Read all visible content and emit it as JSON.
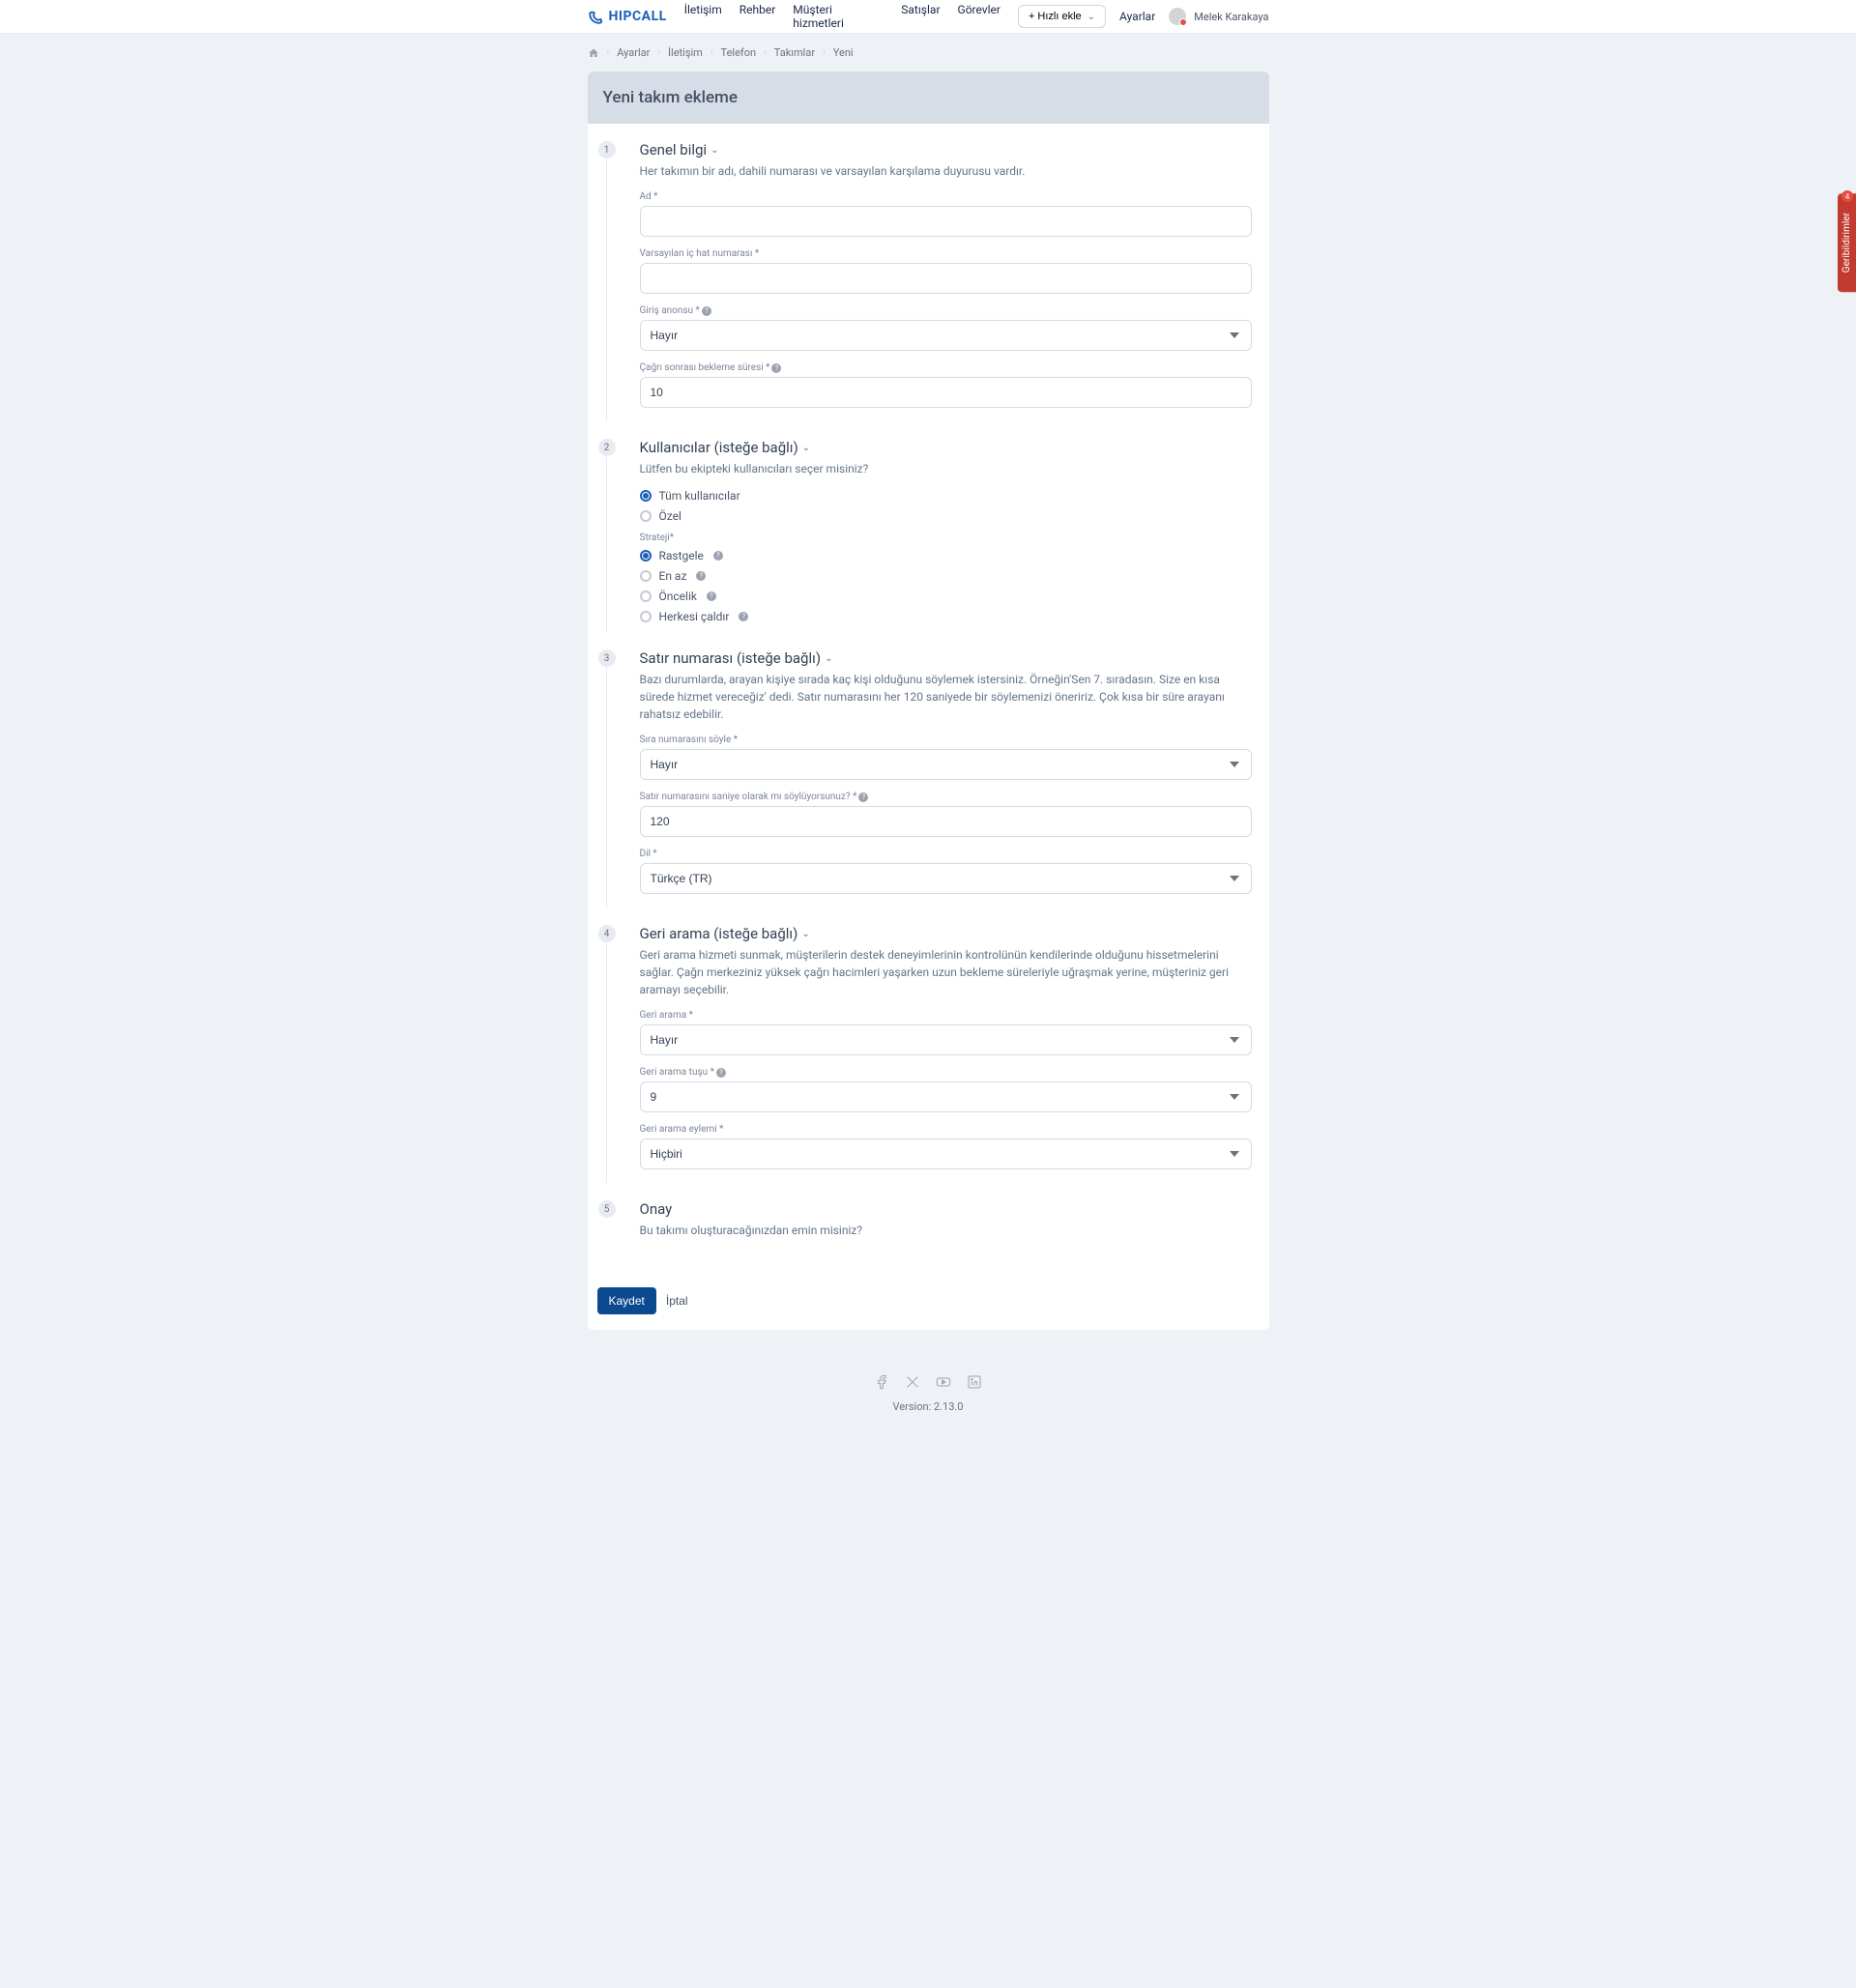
{
  "brand": "HIPCALL",
  "nav": {
    "items": [
      "İletişim",
      "Rehber",
      "Müşteri hizmetleri",
      "Satışlar",
      "Görevler"
    ]
  },
  "header": {
    "quick_add": "+ Hızlı ekle",
    "settings": "Ayarlar",
    "user_name": "Melek Karakaya"
  },
  "breadcrumb": {
    "items": [
      "Ayarlar",
      "İletişim",
      "Telefon",
      "Takımlar",
      "Yeni"
    ]
  },
  "page": {
    "title": "Yeni takım ekleme"
  },
  "steps": {
    "s1": {
      "num": "1",
      "title": "Genel bilgi",
      "desc": "Her takımın bir adı, dahili numarası ve varsayılan karşılama duyurusu vardır.",
      "name_label": "Ad *",
      "ext_label": "Varsayılan iç hat numarası *",
      "greeting_label": "Giriş anonsu *",
      "greeting_value": "Hayır",
      "wait_label": "Çağrı sonrası bekleme süresi *",
      "wait_value": "10"
    },
    "s2": {
      "num": "2",
      "title": "Kullanıcılar (isteğe bağlı)",
      "desc": "Lütfen bu ekipteki kullanıcıları seçer misiniz?",
      "user_all": "Tüm kullanıcılar",
      "user_custom": "Özel",
      "strategy_label": "Strateji*",
      "strat_random": "Rastgele",
      "strat_least": "En az",
      "strat_priority": "Öncelik",
      "strat_ringall": "Herkesi çaldır"
    },
    "s3": {
      "num": "3",
      "title": "Satır numarası (isteğe bağlı)",
      "desc": "Bazı durumlarda, arayan kişiye sırada kaç kişi olduğunu söylemek istersiniz. Örneğin'Sen 7. sıradasın. Size en kısa sürede hizmet vereceğiz' dedi. Satır numarasını her 120 saniyede bir söylemenizi öneririz. Çok kısa bir süre arayanı rahatsız edebilir.",
      "say_label": "Sıra numarasını söyle *",
      "say_value": "Hayır",
      "sec_label": "Satır numarasını saniye olarak mı söylüyorsunuz? *",
      "sec_value": "120",
      "lang_label": "Dil *",
      "lang_value": "Türkçe (TR)"
    },
    "s4": {
      "num": "4",
      "title": "Geri arama (isteğe bağlı)",
      "desc": "Geri arama hizmeti sunmak, müşterilerin destek deneyimlerinin kontrolünün kendilerinde olduğunu hissetmelerini sağlar. Çağrı merkeziniz yüksek çağrı hacimleri yaşarken uzun bekleme süreleriyle uğraşmak yerine, müşteriniz geri aramayı seçebilir.",
      "cb_label": "Geri arama *",
      "cb_value": "Hayır",
      "key_label": "Geri arama tuşu *",
      "key_value": "9",
      "action_label": "Geri arama eylemi *",
      "action_value": "Hiçbiri"
    },
    "s5": {
      "num": "5",
      "title": "Onay",
      "desc": "Bu takımı oluşturacağınızdan emin misiniz?"
    }
  },
  "actions": {
    "save": "Kaydet",
    "cancel": "İptal"
  },
  "footer": {
    "version": "Version: 2.13.0"
  },
  "feedback": {
    "label": "Geribildirimler",
    "count": "4"
  }
}
